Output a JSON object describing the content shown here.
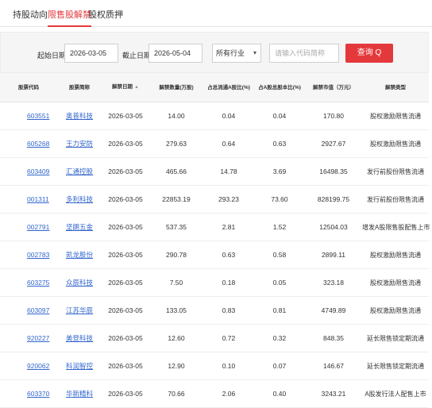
{
  "tabs": [
    {
      "label": "持股动向"
    },
    {
      "label": "限售股解禁"
    },
    {
      "label": "股权质押"
    }
  ],
  "filter": {
    "start_label": "起始日期：",
    "start_value": "2026-03-05",
    "end_label": "截止日期：",
    "end_value": "2026-05-04",
    "industry_value": "所有行业",
    "search_placeholder": "请输入代码简称",
    "query_label": "查询 Q"
  },
  "table": {
    "headers": [
      "股票代码",
      "股票简称",
      "解禁日期",
      "解禁数量(万股)",
      "占总流通A股比(%)",
      "占A股总股本比(%)",
      "解禁市值（万元）",
      "解禁类型"
    ],
    "rows": [
      {
        "code": "603551",
        "name": "奥普科技",
        "date": "2026-03-05",
        "qty": "14.00",
        "pct_float": "0.04",
        "pct_total": "0.04",
        "value": "170.80",
        "type": "股权激励限售流通"
      },
      {
        "code": "605268",
        "name": "王力安防",
        "date": "2026-03-05",
        "qty": "279.63",
        "pct_float": "0.64",
        "pct_total": "0.63",
        "value": "2927.67",
        "type": "股权激励限售流通"
      },
      {
        "code": "603409",
        "name": "汇通控股",
        "date": "2026-03-05",
        "qty": "465.66",
        "pct_float": "14.78",
        "pct_total": "3.69",
        "value": "16498.35",
        "type": "发行前股份限售流通"
      },
      {
        "code": "001311",
        "name": "多利科技",
        "date": "2026-03-05",
        "qty": "22853.19",
        "pct_float": "293.23",
        "pct_total": "73.60",
        "value": "828199.75",
        "type": "发行前股份限售流通"
      },
      {
        "code": "002791",
        "name": "坚朗五金",
        "date": "2026-03-05",
        "qty": "537.35",
        "pct_float": "2.81",
        "pct_total": "1.52",
        "value": "12504.03",
        "type": "增发A股限售股配售上市"
      },
      {
        "code": "002783",
        "name": "凯龙股份",
        "date": "2026-03-05",
        "qty": "290.78",
        "pct_float": "0.63",
        "pct_total": "0.58",
        "value": "2899.11",
        "type": "股权激励限售流通"
      },
      {
        "code": "603275",
        "name": "众辰科技",
        "date": "2026-03-05",
        "qty": "7.50",
        "pct_float": "0.18",
        "pct_total": "0.05",
        "value": "323.18",
        "type": "股权激励限售流通"
      },
      {
        "code": "603097",
        "name": "江苏华辰",
        "date": "2026-03-05",
        "qty": "133.05",
        "pct_float": "0.83",
        "pct_total": "0.81",
        "value": "4749.89",
        "type": "股权激励限售流通"
      },
      {
        "code": "920227",
        "name": "美登科技",
        "date": "2026-03-05",
        "qty": "12.60",
        "pct_float": "0.72",
        "pct_total": "0.32",
        "value": "848.35",
        "type": "延长限售锁定期流通"
      },
      {
        "code": "920062",
        "name": "科润智控",
        "date": "2026-03-05",
        "qty": "12.90",
        "pct_float": "0.10",
        "pct_total": "0.07",
        "value": "146.67",
        "type": "延长限售锁定期流通"
      },
      {
        "code": "603370",
        "name": "华新精科",
        "date": "2026-03-05",
        "qty": "70.66",
        "pct_float": "2.06",
        "pct_total": "0.40",
        "value": "3243.21",
        "type": "A股发行法人配售上市"
      }
    ]
  }
}
